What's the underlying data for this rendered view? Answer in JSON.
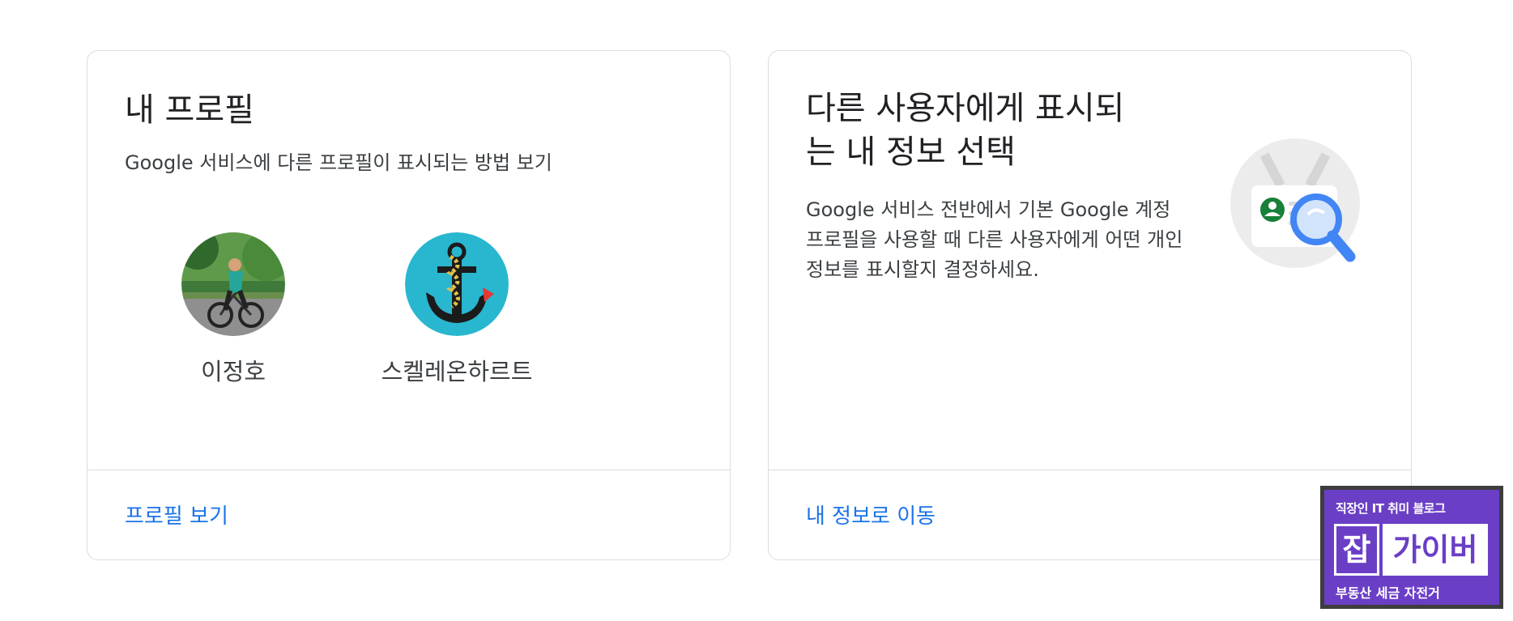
{
  "profile_card": {
    "title": "내 프로필",
    "subtitle": "Google 서비스에 다른 프로필이 표시되는 방법 보기",
    "profiles": [
      {
        "name": "이정호"
      },
      {
        "name": "스켈레온하르트"
      }
    ],
    "link_label": "프로필 보기"
  },
  "info_card": {
    "title_line1": "다른 사용자에게 표시되",
    "title_line2": "는 내 정보 선택",
    "description": "Google 서비스 전반에서 기본 Google 계정 프로필을 사용할 때 다른 사용자에게 어떤 개인 정보를 표시할지 결정하세요.",
    "link_label": "내 정보로 이동"
  },
  "badge": {
    "top_text": "직장인 IT 취미 블로그",
    "box1_text": "잡",
    "box2_text": "가이버",
    "bottom_text": "부동산 세금 자전거"
  },
  "colors": {
    "link": "#1a73e8",
    "border": "#dadce0",
    "badge_purple": "#6a3fc6"
  }
}
